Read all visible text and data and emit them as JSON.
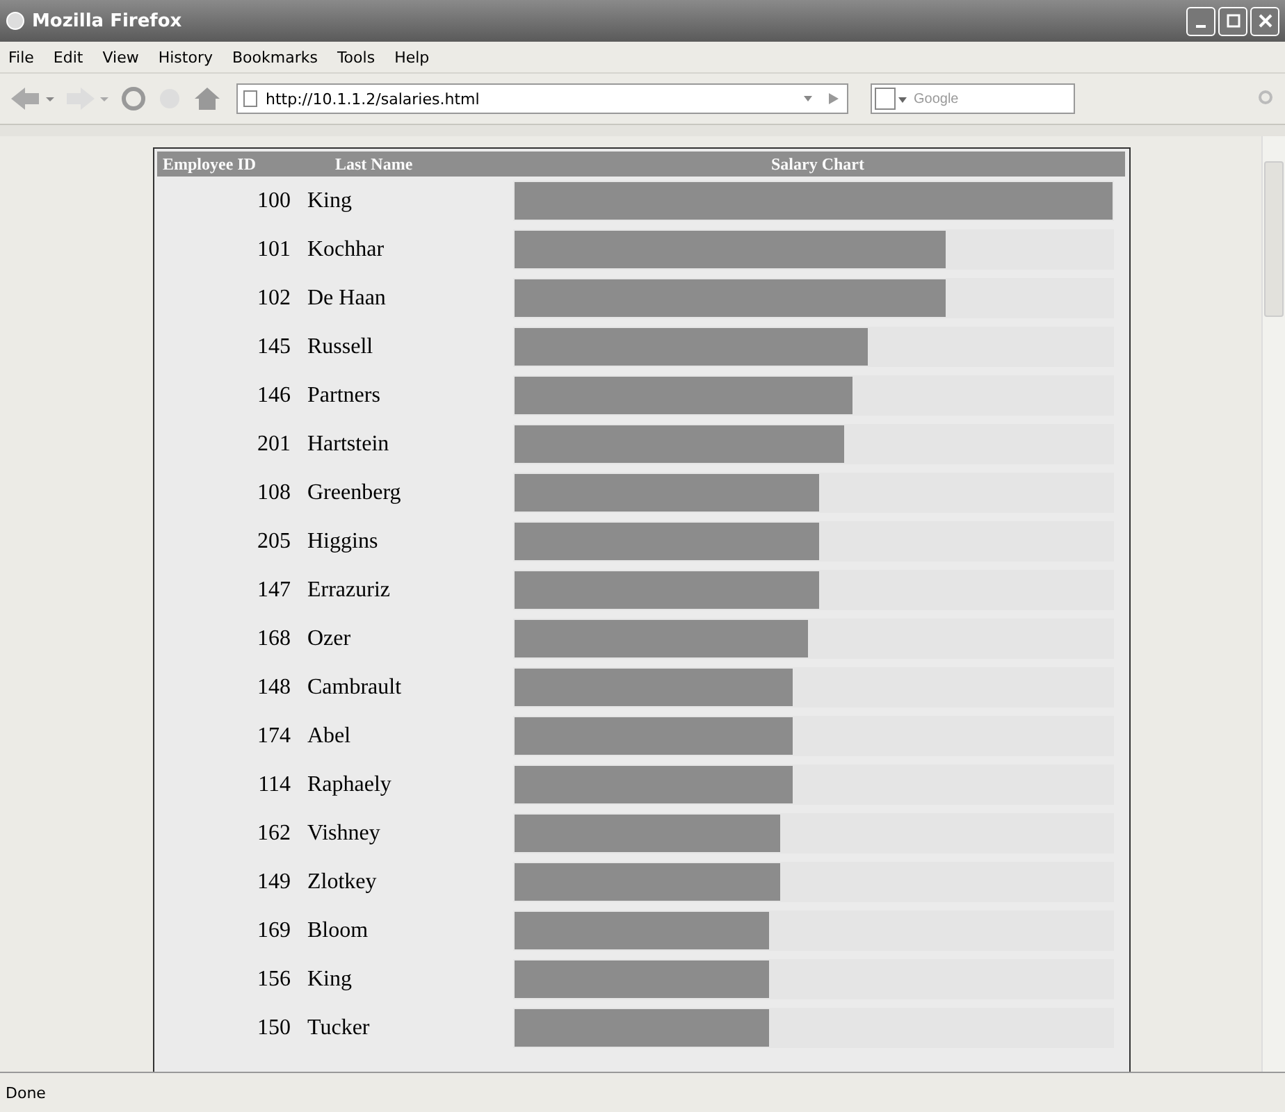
{
  "window": {
    "title": "Mozilla Firefox"
  },
  "menu": [
    "File",
    "Edit",
    "View",
    "History",
    "Bookmarks",
    "Tools",
    "Help"
  ],
  "address": {
    "value": "http://10.1.1.2/salaries.html"
  },
  "search": {
    "placeholder": "Google"
  },
  "table": {
    "columns": [
      "Employee ID",
      "Last Name",
      "Salary Chart"
    ],
    "rows": [
      {
        "id": "100",
        "name": "King",
        "level": 1
      },
      {
        "id": "101",
        "name": "Kochhar",
        "level": 0.72
      },
      {
        "id": "102",
        "name": "De Haan",
        "level": 0.72
      },
      {
        "id": "145",
        "name": "Russell",
        "level": 0.59
      },
      {
        "id": "146",
        "name": "Partners",
        "level": 0.565
      },
      {
        "id": "201",
        "name": "Hartstein",
        "level": 0.55
      },
      {
        "id": "108",
        "name": "Greenberg",
        "level": 0.51
      },
      {
        "id": "205",
        "name": "Higgins",
        "level": 0.51
      },
      {
        "id": "147",
        "name": "Errazuriz",
        "level": 0.51
      },
      {
        "id": "168",
        "name": "Ozer",
        "level": 0.49
      },
      {
        "id": "148",
        "name": "Cambrault",
        "level": 0.465
      },
      {
        "id": "174",
        "name": "Abel",
        "level": 0.465
      },
      {
        "id": "114",
        "name": "Raphaely",
        "level": 0.465
      },
      {
        "id": "162",
        "name": "Vishney",
        "level": 0.445
      },
      {
        "id": "149",
        "name": "Zlotkey",
        "level": 0.445
      },
      {
        "id": "169",
        "name": "Bloom",
        "level": 0.425
      },
      {
        "id": "156",
        "name": "King",
        "level": 0.425
      },
      {
        "id": "150",
        "name": "Tucker",
        "level": 0.425
      }
    ]
  },
  "status_bar": {
    "text": "Done"
  }
}
